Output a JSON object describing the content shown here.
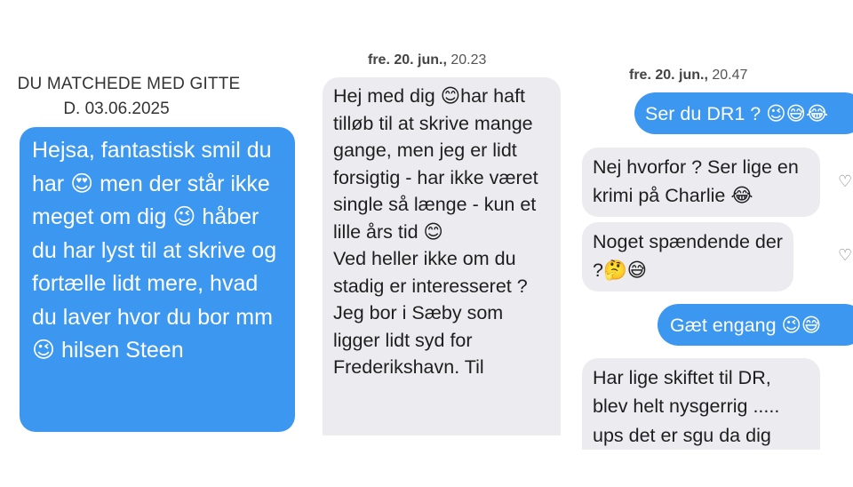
{
  "panel1": {
    "match_title": "DU MATCHEDE MED GITTE",
    "match_date": "D. 03.06.2025",
    "message": "Hejsa, fantastisk smil du har 😍 men der står ikke meget om dig 😉 håber du har lyst til at skrive og fortælle lidt  mere, hvad du laver hvor du bor mm 😉 hilsen Steen"
  },
  "panel2": {
    "timestamp_day": "fre. 20. jun.,",
    "timestamp_time": "20.23",
    "message": "Hej med dig 😊har haft tilløb til at skrive mange gange, men jeg er lidt forsigtig - har ikke været single så længe - kun et lille års tid 😊\nVed heller ikke om du stadig er interesseret ?\nJeg bor i Sæby som ligger lidt syd for Frederikshavn. Til"
  },
  "panel3": {
    "timestamp_day": "fre. 20. jun.,",
    "timestamp_time": "20.47",
    "messages": [
      "Ser du DR1 ? 😉😅😂",
      "Nej hvorfor ? Ser lige en krimi på Charlie 😂",
      "Noget spændende der ?🤔😅",
      "Gæt engang 😉😅",
      "Har lige skiftet til DR, blev helt nysgerrig ..... ups det er sgu da dig"
    ],
    "like_icon": "heart-outline-icon"
  },
  "colors": {
    "outgoing_bubble": "#3b97f0",
    "incoming_bubble": "#ececf0"
  }
}
